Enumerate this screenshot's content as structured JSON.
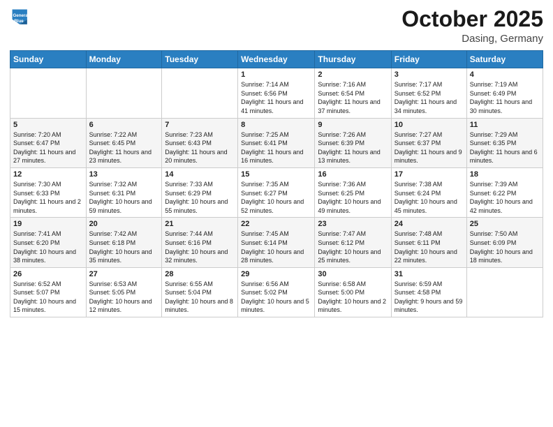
{
  "header": {
    "logo_line1": "General",
    "logo_line2": "Blue",
    "month": "October 2025",
    "location": "Dasing, Germany"
  },
  "weekdays": [
    "Sunday",
    "Monday",
    "Tuesday",
    "Wednesday",
    "Thursday",
    "Friday",
    "Saturday"
  ],
  "weeks": [
    [
      {
        "day": "",
        "info": ""
      },
      {
        "day": "",
        "info": ""
      },
      {
        "day": "",
        "info": ""
      },
      {
        "day": "1",
        "info": "Sunrise: 7:14 AM\nSunset: 6:56 PM\nDaylight: 11 hours and 41 minutes."
      },
      {
        "day": "2",
        "info": "Sunrise: 7:16 AM\nSunset: 6:54 PM\nDaylight: 11 hours and 37 minutes."
      },
      {
        "day": "3",
        "info": "Sunrise: 7:17 AM\nSunset: 6:52 PM\nDaylight: 11 hours and 34 minutes."
      },
      {
        "day": "4",
        "info": "Sunrise: 7:19 AM\nSunset: 6:49 PM\nDaylight: 11 hours and 30 minutes."
      }
    ],
    [
      {
        "day": "5",
        "info": "Sunrise: 7:20 AM\nSunset: 6:47 PM\nDaylight: 11 hours and 27 minutes."
      },
      {
        "day": "6",
        "info": "Sunrise: 7:22 AM\nSunset: 6:45 PM\nDaylight: 11 hours and 23 minutes."
      },
      {
        "day": "7",
        "info": "Sunrise: 7:23 AM\nSunset: 6:43 PM\nDaylight: 11 hours and 20 minutes."
      },
      {
        "day": "8",
        "info": "Sunrise: 7:25 AM\nSunset: 6:41 PM\nDaylight: 11 hours and 16 minutes."
      },
      {
        "day": "9",
        "info": "Sunrise: 7:26 AM\nSunset: 6:39 PM\nDaylight: 11 hours and 13 minutes."
      },
      {
        "day": "10",
        "info": "Sunrise: 7:27 AM\nSunset: 6:37 PM\nDaylight: 11 hours and 9 minutes."
      },
      {
        "day": "11",
        "info": "Sunrise: 7:29 AM\nSunset: 6:35 PM\nDaylight: 11 hours and 6 minutes."
      }
    ],
    [
      {
        "day": "12",
        "info": "Sunrise: 7:30 AM\nSunset: 6:33 PM\nDaylight: 11 hours and 2 minutes."
      },
      {
        "day": "13",
        "info": "Sunrise: 7:32 AM\nSunset: 6:31 PM\nDaylight: 10 hours and 59 minutes."
      },
      {
        "day": "14",
        "info": "Sunrise: 7:33 AM\nSunset: 6:29 PM\nDaylight: 10 hours and 55 minutes."
      },
      {
        "day": "15",
        "info": "Sunrise: 7:35 AM\nSunset: 6:27 PM\nDaylight: 10 hours and 52 minutes."
      },
      {
        "day": "16",
        "info": "Sunrise: 7:36 AM\nSunset: 6:25 PM\nDaylight: 10 hours and 49 minutes."
      },
      {
        "day": "17",
        "info": "Sunrise: 7:38 AM\nSunset: 6:24 PM\nDaylight: 10 hours and 45 minutes."
      },
      {
        "day": "18",
        "info": "Sunrise: 7:39 AM\nSunset: 6:22 PM\nDaylight: 10 hours and 42 minutes."
      }
    ],
    [
      {
        "day": "19",
        "info": "Sunrise: 7:41 AM\nSunset: 6:20 PM\nDaylight: 10 hours and 38 minutes."
      },
      {
        "day": "20",
        "info": "Sunrise: 7:42 AM\nSunset: 6:18 PM\nDaylight: 10 hours and 35 minutes."
      },
      {
        "day": "21",
        "info": "Sunrise: 7:44 AM\nSunset: 6:16 PM\nDaylight: 10 hours and 32 minutes."
      },
      {
        "day": "22",
        "info": "Sunrise: 7:45 AM\nSunset: 6:14 PM\nDaylight: 10 hours and 28 minutes."
      },
      {
        "day": "23",
        "info": "Sunrise: 7:47 AM\nSunset: 6:12 PM\nDaylight: 10 hours and 25 minutes."
      },
      {
        "day": "24",
        "info": "Sunrise: 7:48 AM\nSunset: 6:11 PM\nDaylight: 10 hours and 22 minutes."
      },
      {
        "day": "25",
        "info": "Sunrise: 7:50 AM\nSunset: 6:09 PM\nDaylight: 10 hours and 18 minutes."
      }
    ],
    [
      {
        "day": "26",
        "info": "Sunrise: 6:52 AM\nSunset: 5:07 PM\nDaylight: 10 hours and 15 minutes."
      },
      {
        "day": "27",
        "info": "Sunrise: 6:53 AM\nSunset: 5:05 PM\nDaylight: 10 hours and 12 minutes."
      },
      {
        "day": "28",
        "info": "Sunrise: 6:55 AM\nSunset: 5:04 PM\nDaylight: 10 hours and 8 minutes."
      },
      {
        "day": "29",
        "info": "Sunrise: 6:56 AM\nSunset: 5:02 PM\nDaylight: 10 hours and 5 minutes."
      },
      {
        "day": "30",
        "info": "Sunrise: 6:58 AM\nSunset: 5:00 PM\nDaylight: 10 hours and 2 minutes."
      },
      {
        "day": "31",
        "info": "Sunrise: 6:59 AM\nSunset: 4:58 PM\nDaylight: 9 hours and 59 minutes."
      },
      {
        "day": "",
        "info": ""
      }
    ]
  ]
}
